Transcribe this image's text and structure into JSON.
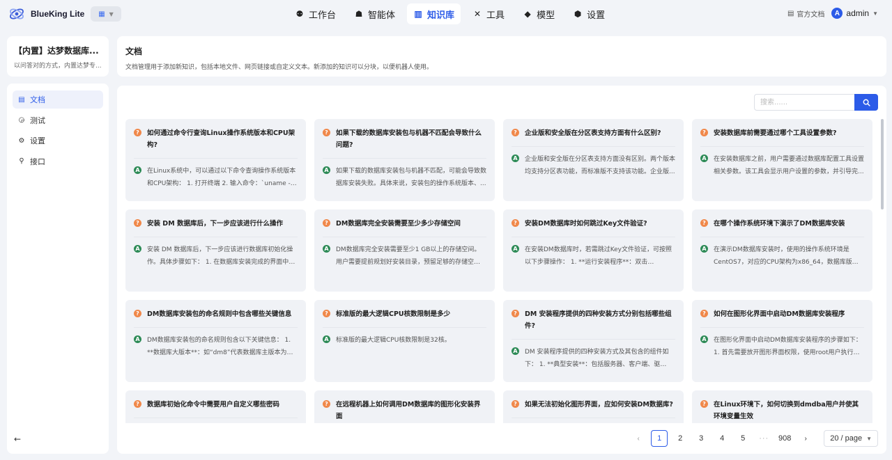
{
  "app": {
    "name": "BlueKing Lite"
  },
  "nav": {
    "items": [
      {
        "label": "工作台",
        "icon": "workbench-icon"
      },
      {
        "label": "智能体",
        "icon": "agent-icon"
      },
      {
        "label": "知识库",
        "icon": "knowledge-icon",
        "active": true
      },
      {
        "label": "工具",
        "icon": "tools-icon"
      },
      {
        "label": "模型",
        "icon": "model-icon"
      },
      {
        "label": "设置",
        "icon": "settings-icon"
      }
    ]
  },
  "header_right": {
    "doc_link": "官方文档",
    "user_initial": "A",
    "user": "admin"
  },
  "kb": {
    "name": "【内置】达梦数据库...",
    "desc": "以问答对的方式，内置达梦专..."
  },
  "sidebar": {
    "items": [
      {
        "label": "文档",
        "icon": "document-icon",
        "active": true
      },
      {
        "label": "测试",
        "icon": "test-icon"
      },
      {
        "label": "设置",
        "icon": "settings-icon"
      },
      {
        "label": "接口",
        "icon": "api-icon"
      }
    ],
    "collapse_icon": "arrow-left-icon"
  },
  "page": {
    "title": "文档",
    "desc": "文档管理用于添加新知识，包括本地文件、网页链接或自定义文本。新添加的知识可以分块，以便机器人使用。"
  },
  "search": {
    "placeholder": "搜索......"
  },
  "qa_marks": {
    "question": "?",
    "answer": "A"
  },
  "qa_items": [
    {
      "q": "如何通过命令行查询Linux操作系统版本和CPU架构?",
      "a": "在Linux系统中，可以通过以下命令查询操作系统版本和CPU架构： 1. 打开终端 2. 输入命令：`uname -a`..."
    },
    {
      "q": "如果下载的数据库安装包与机器不匹配会导致什么问题?",
      "a": "如果下载的数据库安装包与机器不匹配，可能会导致数据库安装失败。具体来说，安装包的操作系统版本、..."
    },
    {
      "q": "企业版和安全版在分区表支持方面有什么区别?",
      "a": "企业版和安全版在分区表支持方面没有区别。两个版本均支持分区表功能，而标准版不支持该功能。企业版..."
    },
    {
      "q": "安装数据库前需要通过哪个工具设置参数?",
      "a": "在安装数据库之前，用户需要通过数据库配置工具设置相关参数。该工具会显示用户设置的参数，并引导完..."
    },
    {
      "q": "安装 DM 数据库后，下一步应该进行什么操作",
      "a": "安装 DM 数据库后，下一步应该进行数据库初始化操作。具体步骤如下： 1. 在数据库安装完成的界面中选..."
    },
    {
      "q": "DM数据库完全安装需要至少多少存储空间",
      "a": "DM数据库完全安装需要至少1 GB以上的存储空间。用户需要提前规划好安装目录，预留足够的存储空间。..."
    },
    {
      "q": "安装DM数据库时如何跳过Key文件验证?",
      "a": "在安装DM数据库时，若需跳过Key文件验证，可按照以下步骤操作： 1. **运行安装程序**：双击setup.ex..."
    },
    {
      "q": "在哪个操作系统环境下演示了DM数据库安装",
      "a": "在演示DM数据库安装时，使用的操作系统环境是CentOS7，对应的CPU架构为x86_64，数据库版本..."
    },
    {
      "q": "DM数据库安装包的命名规则中包含哪些关键信息",
      "a": "DM数据库安装包的命名规则包含以下关键信息： 1. **数据库大版本**：如“dm8”代表数据库主版本为8。..."
    },
    {
      "q": "标准版的最大逻辑CPU核数限制是多少",
      "a": "标准版的最大逻辑CPU核数限制是32核。"
    },
    {
      "q": "DM 安装程序提供的四种安装方式分别包括哪些组件?",
      "a": "DM 安装程序提供的四种安装方式及其包含的组件如下： 1. **典型安装**：包括服务器、客户端、驱动、..."
    },
    {
      "q": "如何在图形化界面中启动DM数据库安装程序",
      "a": "在图形化界面中启动DM数据库安装程序的步骤如下： 1. 首先需要放开图形界面权限，使用root用户执行以..."
    },
    {
      "q": "数据库初始化命令中需要用户自定义哪些密码",
      "a": ""
    },
    {
      "q": "在远程机器上如何调用DM数据库的图形化安装界面",
      "a": ""
    },
    {
      "q": "如果无法初始化图形界面，应如何安装DM数据库?",
      "a": ""
    },
    {
      "q": "在Linux环境下，如何切换到dmdba用户并使其环境变量生效",
      "a": ""
    }
  ],
  "pagination": {
    "prev_icon": "chevron-left-icon",
    "pages": [
      "1",
      "2",
      "3",
      "4",
      "5"
    ],
    "current": "1",
    "ellipsis": "···",
    "last": "908",
    "next_icon": "chevron-right-icon",
    "page_size": "20 / page"
  }
}
